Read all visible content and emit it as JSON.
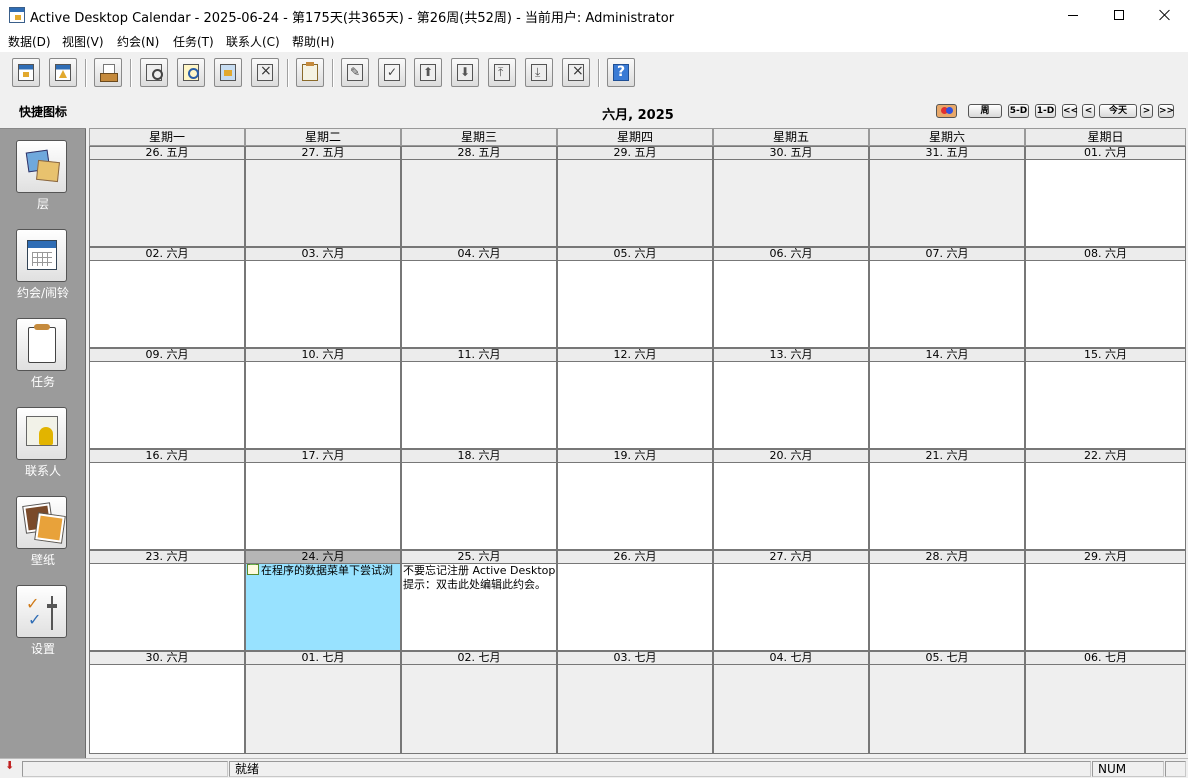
{
  "window": {
    "title": "Active Desktop Calendar - 2025-06-24 - 第175天(共365天) - 第26周(共52周) - 当前用户: Administrator"
  },
  "menu": [
    "数据(D)",
    "视图(V)",
    "约会(N)",
    "任务(T)",
    "联系人(C)",
    "帮助(H)"
  ],
  "toolbar": {
    "buttons": [
      {
        "name": "new-calendar-button",
        "icon": "calendar-icon"
      },
      {
        "name": "new-alarm-button",
        "icon": "alarm-icon"
      },
      {
        "name": "print-button",
        "icon": "printer-icon"
      },
      {
        "name": "find-button",
        "icon": "magnifier-icon"
      },
      {
        "name": "find-next-button",
        "icon": "magnifier-icon"
      },
      {
        "name": "picture-button",
        "icon": "image-icon"
      },
      {
        "name": "delete-item-button",
        "icon": "delete-icon"
      },
      {
        "name": "new-task-button",
        "icon": "clipboard-icon"
      },
      {
        "name": "edit-task-button",
        "icon": "edit-icon"
      },
      {
        "name": "complete-task-button",
        "icon": "check-icon"
      },
      {
        "name": "move-up-button",
        "icon": "arrow-up-icon"
      },
      {
        "name": "move-down-button",
        "icon": "arrow-down-icon"
      },
      {
        "name": "move-top-button",
        "icon": "arrow-top-icon"
      },
      {
        "name": "move-bottom-button",
        "icon": "arrow-bottom-icon"
      },
      {
        "name": "delete-task-button",
        "icon": "delete-icon"
      },
      {
        "name": "help-button",
        "icon": "help-icon"
      }
    ]
  },
  "sidebar": {
    "header": "快捷图标",
    "items": [
      {
        "label": "层",
        "icon": "layers-icon"
      },
      {
        "label": "约会/闹铃",
        "icon": "calendar-icon"
      },
      {
        "label": "任务",
        "icon": "clipboard-icon"
      },
      {
        "label": "联系人",
        "icon": "contact-card-icon"
      },
      {
        "label": "壁纸",
        "icon": "photo-icon"
      },
      {
        "label": "设置",
        "icon": "settings-icon"
      }
    ]
  },
  "calendar": {
    "title": "六月, 2025",
    "nav": {
      "color": "",
      "week": "周",
      "five_day": "5-D",
      "one_day": "1-D",
      "prev_prev": "<<",
      "prev": "<",
      "today": "今天",
      "next": ">",
      "next_next": ">>"
    },
    "weekdays": [
      "星期一",
      "星期二",
      "星期三",
      "星期四",
      "星期五",
      "星期六",
      "星期日"
    ],
    "weeks": [
      [
        {
          "label": "26. 五月",
          "other": true
        },
        {
          "label": "27. 五月",
          "other": true
        },
        {
          "label": "28. 五月",
          "other": true
        },
        {
          "label": "29. 五月",
          "other": true
        },
        {
          "label": "30. 五月",
          "other": true
        },
        {
          "label": "31. 五月",
          "other": true
        },
        {
          "label": "01. 六月",
          "other": false
        }
      ],
      [
        {
          "label": "02. 六月",
          "other": false
        },
        {
          "label": "03. 六月",
          "other": false
        },
        {
          "label": "04. 六月",
          "other": false
        },
        {
          "label": "05. 六月",
          "other": false
        },
        {
          "label": "06. 六月",
          "other": false
        },
        {
          "label": "07. 六月",
          "other": false
        },
        {
          "label": "08. 六月",
          "other": false
        }
      ],
      [
        {
          "label": "09. 六月",
          "other": false
        },
        {
          "label": "10. 六月",
          "other": false
        },
        {
          "label": "11. 六月",
          "other": false
        },
        {
          "label": "12. 六月",
          "other": false
        },
        {
          "label": "13. 六月",
          "other": false
        },
        {
          "label": "14. 六月",
          "other": false
        },
        {
          "label": "15. 六月",
          "other": false
        }
      ],
      [
        {
          "label": "16. 六月",
          "other": false
        },
        {
          "label": "17. 六月",
          "other": false
        },
        {
          "label": "18. 六月",
          "other": false
        },
        {
          "label": "19. 六月",
          "other": false
        },
        {
          "label": "20. 六月",
          "other": false
        },
        {
          "label": "21. 六月",
          "other": false
        },
        {
          "label": "22. 六月",
          "other": false
        }
      ],
      [
        {
          "label": "23. 六月",
          "other": false
        },
        {
          "label": "24. 六月",
          "other": false,
          "today": true,
          "events": [
            {
              "text": "在程序的数据菜单下尝试浏",
              "icon": "task-icon"
            }
          ]
        },
        {
          "label": "25. 六月",
          "other": false,
          "events": [
            {
              "text": "不要忘记注册 Active Desktop C"
            },
            {
              "text": "提示：双击此处编辑此约会。"
            }
          ]
        },
        {
          "label": "26. 六月",
          "other": false
        },
        {
          "label": "27. 六月",
          "other": false
        },
        {
          "label": "28. 六月",
          "other": false
        },
        {
          "label": "29. 六月",
          "other": false
        }
      ],
      [
        {
          "label": "30. 六月",
          "other": false
        },
        {
          "label": "01. 七月",
          "other": true
        },
        {
          "label": "02. 七月",
          "other": true
        },
        {
          "label": "03. 七月",
          "other": true
        },
        {
          "label": "04. 七月",
          "other": true
        },
        {
          "label": "05. 七月",
          "other": true
        },
        {
          "label": "06. 七月",
          "other": true
        }
      ]
    ]
  },
  "status": {
    "text": "就绪",
    "num": "NUM"
  }
}
